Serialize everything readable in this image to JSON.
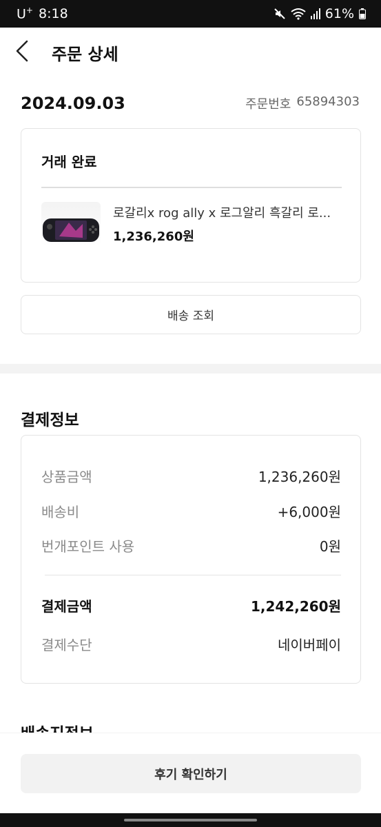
{
  "status_bar": {
    "carrier": "U",
    "carrier_sup": "+",
    "time": "8:18",
    "battery": "61%"
  },
  "header": {
    "title": "주문 상세"
  },
  "order": {
    "date": "2024.09.03",
    "number_label": "주문번호",
    "number": "65894303",
    "status": "거래 완료",
    "product": {
      "name": "로갈리x rog ally x 로그알리 흑갈리 로...",
      "price": "1,236,260원"
    },
    "delivery_button": "배송 조회"
  },
  "payment": {
    "title": "결제정보",
    "rows": [
      {
        "label": "상품금액",
        "value": "1,236,260원"
      },
      {
        "label": "배송비",
        "value": "+6,000원"
      },
      {
        "label": "번개포인트 사용",
        "value": "0원"
      }
    ],
    "total": {
      "label": "결제금액",
      "value": "1,242,260원"
    },
    "method": {
      "label": "결제수단",
      "value": "네이버페이"
    }
  },
  "next_section_title": "배송지정보",
  "bottom": {
    "review_button": "후기 확인하기"
  },
  "colors": {
    "status_bar_bg": "#111111",
    "divider_band": "#f3f3f3",
    "card_border": "#e3e3e3",
    "button_gray": "#f2f2f2"
  }
}
